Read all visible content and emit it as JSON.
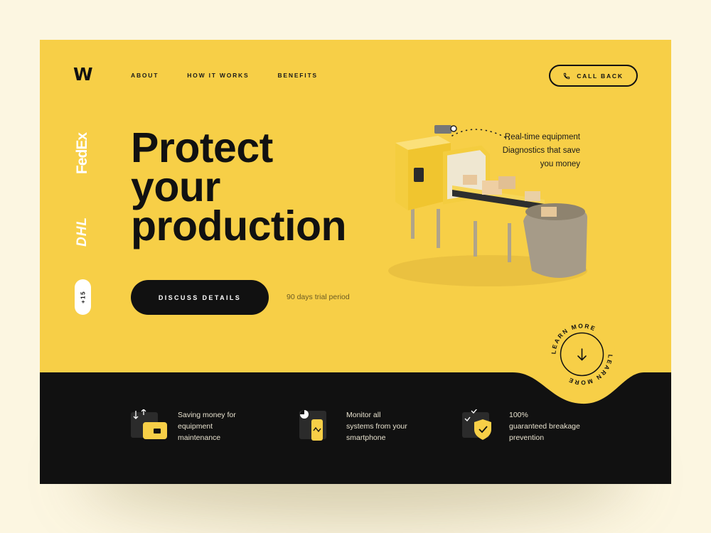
{
  "logo": "W",
  "nav": {
    "items": [
      "ABOUT",
      "HOW IT WORKS",
      "BENEFITS"
    ]
  },
  "call_back": {
    "label": "CALL BACK",
    "icon": "phone-icon"
  },
  "brands": {
    "fedex": "FedEx",
    "dhl": "DHL",
    "more": "+15"
  },
  "hero": {
    "title_lines": [
      "Protect",
      "your",
      "production"
    ],
    "cta_label": "DISCUSS DETAILS",
    "trial_text": "90 days trial period"
  },
  "realtime": {
    "lines": [
      "Real-time equipment",
      "Diagnostics that save",
      "you money"
    ]
  },
  "learn_more": {
    "label": "LEARN MORE",
    "icon": "arrow-down-icon"
  },
  "features": [
    {
      "icon": "wallet-icon",
      "text": "Saving money for\nequipment\nmaintenance"
    },
    {
      "icon": "smartphone-icon",
      "text": "Monitor all\nsystems from your\nsmartphone"
    },
    {
      "icon": "shield-check-icon",
      "text": "100%\nguaranteed breakage\nprevention"
    }
  ],
  "colors": {
    "accent": "#f7cf47",
    "dark": "#111111",
    "background": "#fcf6e1"
  }
}
